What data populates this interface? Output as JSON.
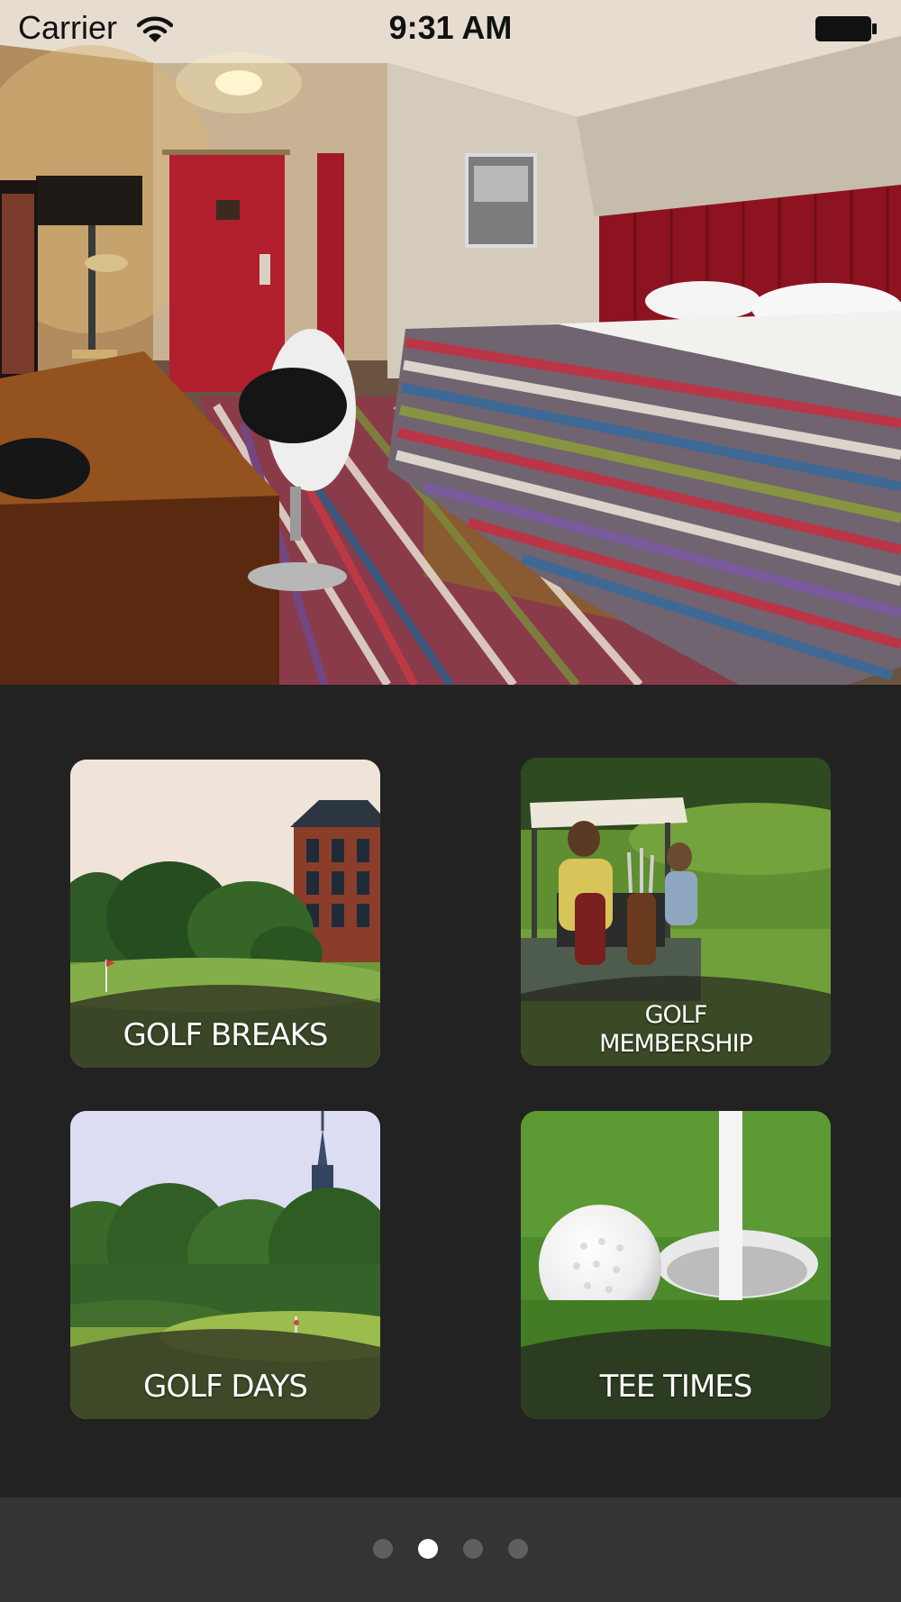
{
  "status_bar": {
    "carrier": "Carrier",
    "time": "9:31 AM"
  },
  "hero": {
    "image": "hotel-bedroom-photo"
  },
  "tiles": [
    {
      "lines": [
        "GOLF BREAKS"
      ],
      "image": "golf-course-with-hotel-photo"
    },
    {
      "lines": [
        "GOLF",
        "MEMBERSHIP"
      ],
      "image": "golf-cart-photo"
    },
    {
      "lines": [
        "GOLF DAYS"
      ],
      "image": "golf-course-with-tower-photo"
    },
    {
      "lines": [
        "TEE TIMES"
      ],
      "image": "golf-ball-at-hole-photo"
    }
  ],
  "page_control": {
    "pages": 4,
    "current": 2
  },
  "colors": {
    "background": "#222222",
    "footer": "#343436",
    "dot_active": "#ffffff",
    "dot_inactive": "#5f5f61"
  }
}
